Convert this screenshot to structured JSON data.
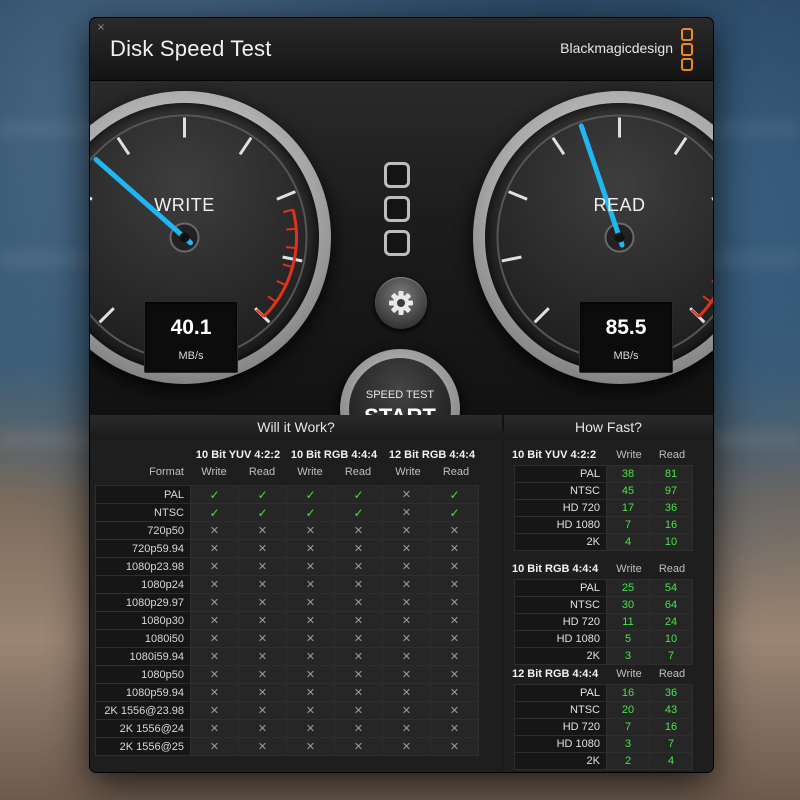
{
  "window": {
    "title": "Disk Speed Test",
    "brand": "Blackmagicdesign",
    "close_glyph": "×"
  },
  "gauges": {
    "write": {
      "label": "WRITE",
      "value": "40.1",
      "unit": "MB/s",
      "needle_fraction": 0.32
    },
    "read": {
      "label": "READ",
      "value": "85.5",
      "unit": "MB/s",
      "needle_fraction": 0.43
    }
  },
  "start_button": {
    "top_label": "SPEED TEST",
    "main_label": "START"
  },
  "settings_icon": "gear-icon",
  "will_it_work": {
    "title": "Will it Work?",
    "format_header": "Format",
    "groups": [
      "10 Bit YUV 4:2:2",
      "10 Bit RGB 4:4:4",
      "12 Bit RGB 4:4:4"
    ],
    "sub_headers": [
      "Write",
      "Read"
    ],
    "rows": [
      {
        "format": "PAL",
        "cells": [
          1,
          1,
          1,
          1,
          0,
          1
        ]
      },
      {
        "format": "NTSC",
        "cells": [
          1,
          1,
          1,
          1,
          0,
          1
        ]
      },
      {
        "format": "720p50",
        "cells": [
          0,
          0,
          0,
          0,
          0,
          0
        ]
      },
      {
        "format": "720p59.94",
        "cells": [
          0,
          0,
          0,
          0,
          0,
          0
        ]
      },
      {
        "format": "1080p23.98",
        "cells": [
          0,
          0,
          0,
          0,
          0,
          0
        ]
      },
      {
        "format": "1080p24",
        "cells": [
          0,
          0,
          0,
          0,
          0,
          0
        ]
      },
      {
        "format": "1080p29.97",
        "cells": [
          0,
          0,
          0,
          0,
          0,
          0
        ]
      },
      {
        "format": "1080p30",
        "cells": [
          0,
          0,
          0,
          0,
          0,
          0
        ]
      },
      {
        "format": "1080i50",
        "cells": [
          0,
          0,
          0,
          0,
          0,
          0
        ]
      },
      {
        "format": "1080i59.94",
        "cells": [
          0,
          0,
          0,
          0,
          0,
          0
        ]
      },
      {
        "format": "1080p50",
        "cells": [
          0,
          0,
          0,
          0,
          0,
          0
        ]
      },
      {
        "format": "1080p59.94",
        "cells": [
          0,
          0,
          0,
          0,
          0,
          0
        ]
      },
      {
        "format": "2K 1556@23.98",
        "cells": [
          0,
          0,
          0,
          0,
          0,
          0
        ]
      },
      {
        "format": "2K 1556@24",
        "cells": [
          0,
          0,
          0,
          0,
          0,
          0
        ]
      },
      {
        "format": "2K 1556@25",
        "cells": [
          0,
          0,
          0,
          0,
          0,
          0
        ]
      }
    ],
    "yes_glyph": "✓",
    "no_glyph": "✕"
  },
  "how_fast": {
    "title": "How Fast?",
    "groups": [
      {
        "name": "10 Bit YUV 4:2:2",
        "write_label": "Write",
        "read_label": "Read",
        "rows": [
          {
            "format": "PAL",
            "write": "38",
            "read": "81"
          },
          {
            "format": "NTSC",
            "write": "45",
            "read": "97"
          },
          {
            "format": "HD 720",
            "write": "17",
            "read": "36"
          },
          {
            "format": "HD 1080",
            "write": "7",
            "read": "16"
          },
          {
            "format": "2K",
            "write": "4",
            "read": "10"
          }
        ]
      },
      {
        "name": "10 Bit RGB 4:4:4",
        "write_label": "Write",
        "read_label": "Read",
        "rows": [
          {
            "format": "PAL",
            "write": "25",
            "read": "54"
          },
          {
            "format": "NTSC",
            "write": "30",
            "read": "64"
          },
          {
            "format": "HD 720",
            "write": "11",
            "read": "24"
          },
          {
            "format": "HD 1080",
            "write": "5",
            "read": "10"
          },
          {
            "format": "2K",
            "write": "3",
            "read": "7"
          }
        ]
      },
      {
        "name": "12 Bit RGB 4:4:4",
        "write_label": "Write",
        "read_label": "Read",
        "rows": [
          {
            "format": "PAL",
            "write": "16",
            "read": "36"
          },
          {
            "format": "NTSC",
            "write": "20",
            "read": "43"
          },
          {
            "format": "HD 720",
            "write": "7",
            "read": "16"
          },
          {
            "format": "HD 1080",
            "write": "3",
            "read": "7"
          },
          {
            "format": "2K",
            "write": "2",
            "read": "4"
          }
        ]
      }
    ]
  },
  "colors": {
    "needle": "#1fb6f2",
    "redline": "#e0321e",
    "ok": "#3ee43e",
    "brand_orange": "#f08a1c"
  }
}
